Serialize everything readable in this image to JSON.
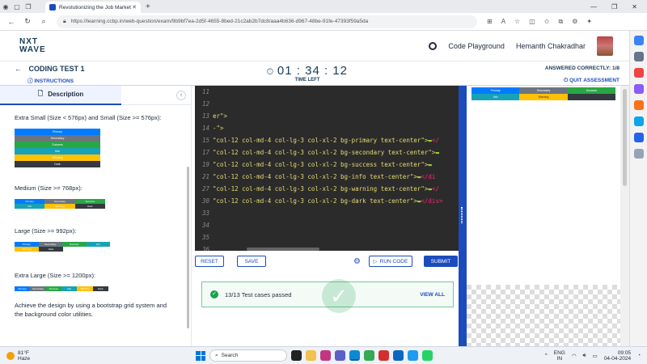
{
  "browser": {
    "tab_title": "Revolutionizing the Job Market |",
    "url": "https://learning.ccbp.in/web-question/exam/9b9bf7ea-2d5f-4655-8bed-21c2ab2b7dc8/aaa4b636-d967-48be-91fe-47393f59a5da"
  },
  "header": {
    "logo_line1": "NXT",
    "logo_line2": "WAVE",
    "code_playground": "Code Playground",
    "user_name": "Hemanth Chakradhar"
  },
  "test": {
    "title": "CODING TEST 1",
    "instructions": "INSTRUCTIONS",
    "timer": "01 : 34 : 12",
    "time_left": "TIME LEFT",
    "answered": "ANSWERED CORRECTLY: 1/8",
    "quit": "QUIT ASSESSMENT"
  },
  "description": {
    "tab_label": "Description",
    "extra_small": "Extra Small (Size < 576px) and Small (Size >= 576px):",
    "medium": "Medium (Size >= 768px):",
    "large": "Large (Size >= 992px):",
    "extra_large": "Extra Large (Size >= 1200px):",
    "summary": "Achieve the design by using a bootstrap grid system and the background color utilities.",
    "color_labels": [
      "Primary",
      "Secondary",
      "Success",
      "Info",
      "Warning",
      "Dark"
    ]
  },
  "editor": {
    "lines": [
      {
        "n": "11",
        "code": ""
      },
      {
        "n": "12",
        "code": ""
      },
      {
        "n": "13",
        "code": "er\">"
      },
      {
        "n": "14",
        "code": "-\">"
      },
      {
        "n": "15",
        "code": "\"col-12 col-md-4  col-lg-3 col-xl-2 bg-primary text-center\">",
        "tail": "</"
      },
      {
        "n": "17",
        "code": "\"col-12  col-md-4 col-lg-3  col-xl-2 bg-secondary text-center\">",
        "tail": ""
      },
      {
        "n": "19",
        "code": "\"col-12 col-md-4   col-lg-3 col-xl-2 bg-success text-center\">",
        "tail": ""
      },
      {
        "n": "21",
        "code": "\"col-12  col-md-4   col-lg-3 col-xl-2 bg-info text-center\">",
        "tail": "</di"
      },
      {
        "n": "27",
        "code": "\"col-12 col-md-4 col-lg-3 col-xl-2 bg-warning text-center\">",
        "tail": "</"
      },
      {
        "n": "30",
        "code": "\"col-12 col-md-4 col-lg-3 col-xl-2 bg-dark text-center\">",
        "tail": "</div>"
      },
      {
        "n": "33",
        "code": ""
      },
      {
        "n": "34",
        "code": ""
      },
      {
        "n": "35",
        "code": ""
      },
      {
        "n": "36",
        "code": ""
      }
    ]
  },
  "toolbar": {
    "reset": "RESET",
    "save": "SAVE",
    "run_code": "RUN CODE",
    "submit": "SUBMIT"
  },
  "results": {
    "passed": "13/13 Test cases passed",
    "view_all": "VIEW ALL"
  },
  "preview": {
    "row1": [
      "Primary",
      "Secondary",
      "Success"
    ],
    "row2": [
      "Info",
      "Warning",
      ""
    ]
  },
  "taskbar": {
    "temp": "81°F",
    "weather": "Haze",
    "search": "Search",
    "lang1": "ENG",
    "lang2": "IN",
    "time": "09:05",
    "date": "04-04-2024"
  },
  "colors": {
    "primary": "#007bff",
    "secondary": "#6c757d",
    "success": "#28a745",
    "info": "#17a2b8",
    "warning": "#ffc107",
    "dark": "#343a40",
    "accent": "#1c4cbc"
  }
}
